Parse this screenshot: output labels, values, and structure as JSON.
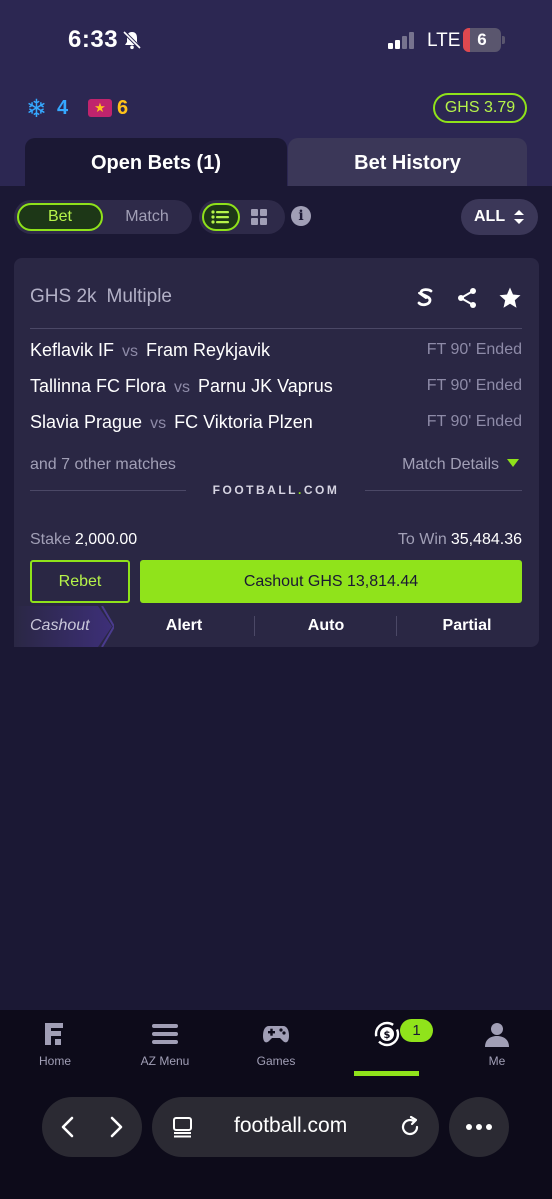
{
  "status_bar": {
    "time": "6:33",
    "network": "LTE",
    "battery": "6"
  },
  "header": {
    "freeze_count": "4",
    "ticket_count": "6",
    "balance": "GHS 3.79"
  },
  "tabs": [
    {
      "label": "Open Bets (1)",
      "active": true
    },
    {
      "label": "Bet History",
      "active": false
    }
  ],
  "filters": {
    "segment": [
      "Bet",
      "Match"
    ],
    "selected_segment": "Bet",
    "view": [
      "list-icon",
      "grid-icon"
    ],
    "sort_label": "ALL"
  },
  "bet": {
    "title_stake": "GHS 2k",
    "title_type": "Multiple",
    "matches": [
      {
        "home": "Keflavik IF",
        "vs": "vs",
        "away": "Fram Reykjavik",
        "status": "FT 90' Ended"
      },
      {
        "home": "Tallinna FC Flora",
        "vs": "vs",
        "away": "Parnu JK Vaprus",
        "status": "FT 90' Ended"
      },
      {
        "home": "Slavia Prague",
        "vs": "vs",
        "away": "FC Viktoria Plzen",
        "status": "FT 90' Ended"
      }
    ],
    "other_matches": "and 7 other matches",
    "match_details": "Match Details",
    "brand": "FOOTBALL",
    "brand_dot": ".",
    "brand_tld": "COM",
    "stake_label": "Stake",
    "stake_value": "2,000.00",
    "towin_label": "To Win",
    "towin_value": "35,484.36",
    "rebet_label": "Rebet",
    "cashout_label": "Cashout GHS 13,814.44",
    "cashout_tag": "Cashout",
    "cashout_options": [
      "Alert",
      "Auto",
      "Partial"
    ]
  },
  "bottom_nav": {
    "items": [
      {
        "label": "Home",
        "icon": "home-logo-icon"
      },
      {
        "label": "AZ Menu",
        "icon": "menu-icon"
      },
      {
        "label": "Games",
        "icon": "gamepad-icon"
      },
      {
        "label": "",
        "icon": "cashout-coin-icon",
        "active": true
      },
      {
        "label": "Me",
        "icon": "person-icon"
      }
    ],
    "badge": "1"
  },
  "browser": {
    "url": "football.com"
  },
  "colors": {
    "accent": "#90e31b",
    "background": "#1b1834",
    "header": "#2c2752",
    "card": "#2a2744"
  }
}
